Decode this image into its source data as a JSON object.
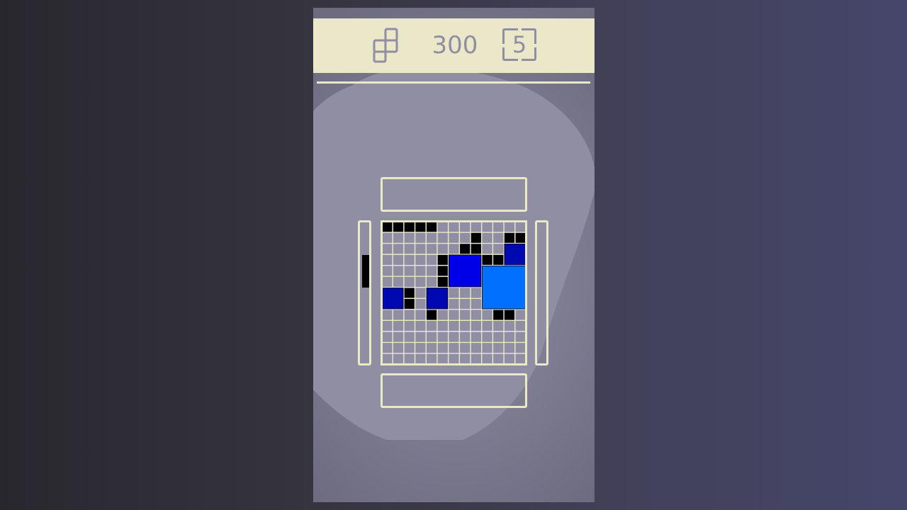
{
  "header": {
    "pieces_icon": "tetromino-outline-icon",
    "score": "300",
    "level": "5",
    "level_icon": "timer-box-icon"
  },
  "colors": {
    "header_bg": "#ebe7c9",
    "text_muted": "#8f8ea3",
    "blob": "#8f8ea3",
    "cell_empty": "#8f8ea3",
    "grid_line": "#ebe7c9",
    "black_cell": "#000000",
    "navy_block": "#0008b0",
    "blue_block": "#0000e8",
    "azure_block": "#0070ff"
  },
  "board": {
    "cols": 13,
    "rows": 13,
    "black_cells": [
      [
        0,
        0
      ],
      [
        1,
        0
      ],
      [
        2,
        0
      ],
      [
        3,
        0
      ],
      [
        4,
        0
      ],
      [
        8,
        1
      ],
      [
        11,
        1
      ],
      [
        12,
        1
      ],
      [
        7,
        2
      ],
      [
        8,
        2
      ],
      [
        5,
        3
      ],
      [
        9,
        3
      ],
      [
        10,
        3
      ],
      [
        5,
        4
      ],
      [
        5,
        5
      ],
      [
        2,
        6
      ],
      [
        2,
        7
      ],
      [
        4,
        8
      ],
      [
        10,
        8
      ],
      [
        11,
        8
      ]
    ],
    "blocks": [
      {
        "col": 11,
        "row": 2,
        "w": 2,
        "h": 2,
        "color": "navy"
      },
      {
        "col": 6,
        "row": 3,
        "w": 3,
        "h": 3,
        "color": "blue"
      },
      {
        "col": 9,
        "row": 4,
        "w": 4,
        "h": 4,
        "color": "azure"
      },
      {
        "col": 0,
        "row": 6,
        "w": 2,
        "h": 2,
        "color": "navy"
      },
      {
        "col": 4,
        "row": 6,
        "w": 2,
        "h": 2,
        "color": "navy"
      }
    ]
  }
}
